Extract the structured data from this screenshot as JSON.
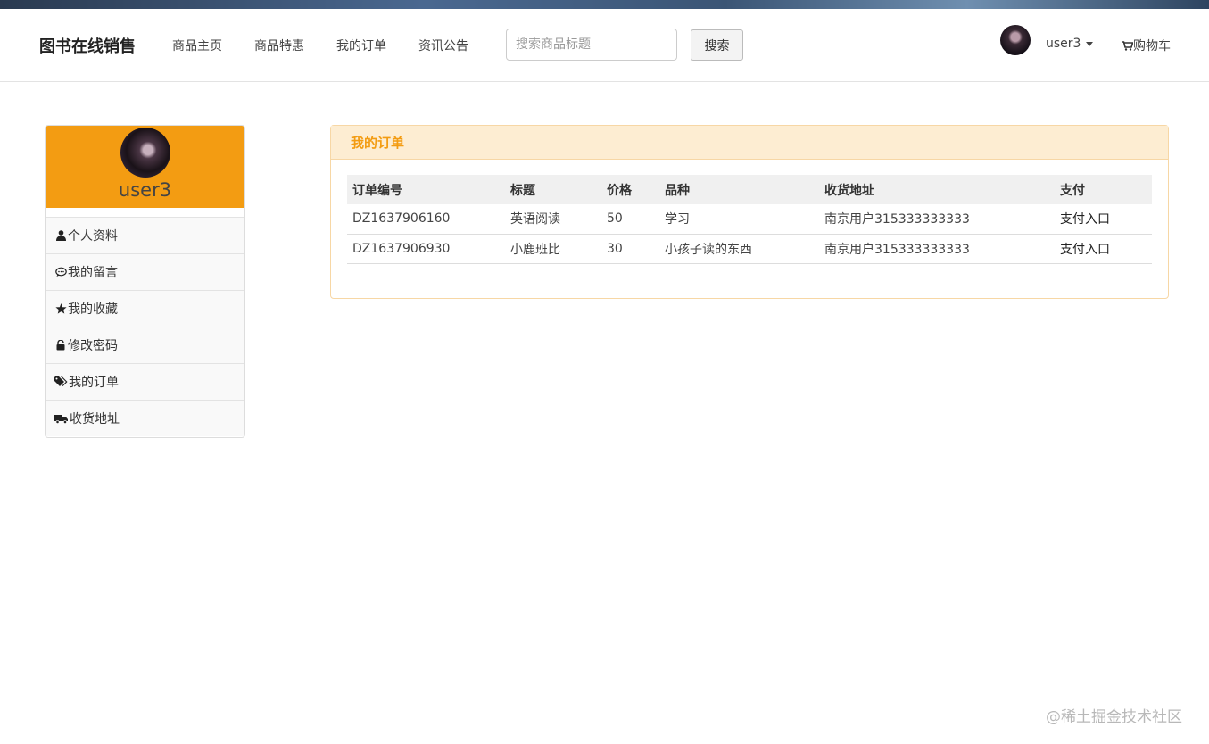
{
  "brand": "图书在线销售",
  "nav": [
    {
      "label": "商品主页"
    },
    {
      "label": "商品特惠"
    },
    {
      "label": "我的订单"
    },
    {
      "label": "资讯公告"
    }
  ],
  "search": {
    "placeholder": "搜索商品标题",
    "value": "",
    "button_label": "搜索"
  },
  "user": {
    "name": "user3"
  },
  "cart_label": "购物车",
  "sidebar": {
    "username": "user3",
    "items": [
      {
        "label": "个人资料",
        "icon": "user-icon"
      },
      {
        "label": "我的留言",
        "icon": "comment-icon"
      },
      {
        "label": "我的收藏",
        "icon": "star-icon"
      },
      {
        "label": "修改密码",
        "icon": "unlock-icon"
      },
      {
        "label": "我的订单",
        "icon": "tags-icon"
      },
      {
        "label": "收货地址",
        "icon": "truck-icon"
      }
    ]
  },
  "orders": {
    "title": "我的订单",
    "columns": [
      "订单编号",
      "标题",
      "价格",
      "品种",
      "收货地址",
      "支付"
    ],
    "rows": [
      {
        "id": "DZ1637906160",
        "title": "英语阅读",
        "price": "50",
        "category": "学习",
        "address": "南京用户315333333333",
        "pay": "支付入口"
      },
      {
        "id": "DZ1637906930",
        "title": "小鹿班比",
        "price": "30",
        "category": "小孩子读的东西",
        "address": "南京用户315333333333",
        "pay": "支付入口"
      }
    ]
  },
  "watermark": "@稀土掘金技术社区",
  "colors": {
    "accent": "#f39c12",
    "panel_header_bg": "#fdedd2",
    "panel_border": "#f7d7a5"
  }
}
